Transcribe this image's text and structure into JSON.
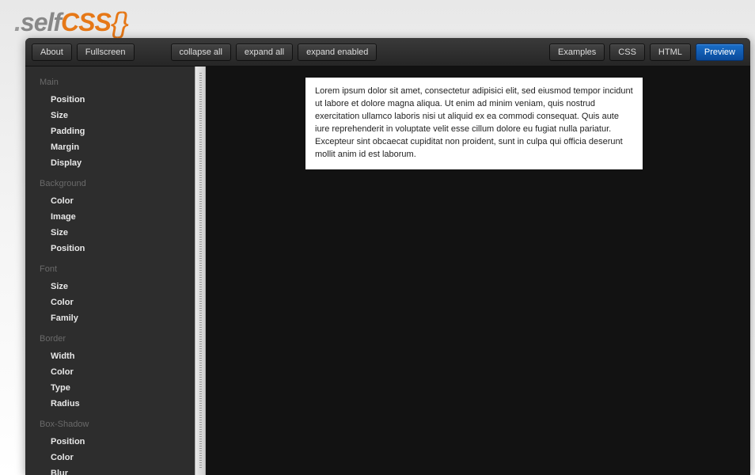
{
  "logo": {
    "dot": ".",
    "self": "self",
    "css": "CSS",
    "braces": "{}"
  },
  "toolbar": {
    "about": "About",
    "fullscreen": "Fullscreen",
    "collapse_all": "collapse all",
    "expand_all": "expand all",
    "expand_enabled": "expand enabled",
    "examples": "Examples",
    "css": "CSS",
    "html": "HTML",
    "preview": "Preview"
  },
  "sidebar": {
    "groups": [
      {
        "name": "Main",
        "items": [
          "Position",
          "Size",
          "Padding",
          "Margin",
          "Display"
        ]
      },
      {
        "name": "Background",
        "items": [
          "Color",
          "Image",
          "Size",
          "Position"
        ]
      },
      {
        "name": "Font",
        "items": [
          "Size",
          "Color",
          "Family"
        ]
      },
      {
        "name": "Border",
        "items": [
          "Width",
          "Color",
          "Type",
          "Radius"
        ]
      },
      {
        "name": "Box-Shadow",
        "items": [
          "Position",
          "Color",
          "Blur"
        ]
      }
    ]
  },
  "preview": {
    "text": "Lorem ipsum dolor sit amet, consectetur adipisici elit, sed eiusmod tempor incidunt ut labore et dolore magna aliqua. Ut enim ad minim veniam, quis nostrud exercitation ullamco laboris nisi ut aliquid ex ea commodi consequat. Quis aute iure reprehenderit in voluptate velit esse cillum dolore eu fugiat nulla pariatur. Excepteur sint obcaecat cupiditat non proident, sunt in culpa qui officia deserunt mollit anim id est laborum."
  }
}
